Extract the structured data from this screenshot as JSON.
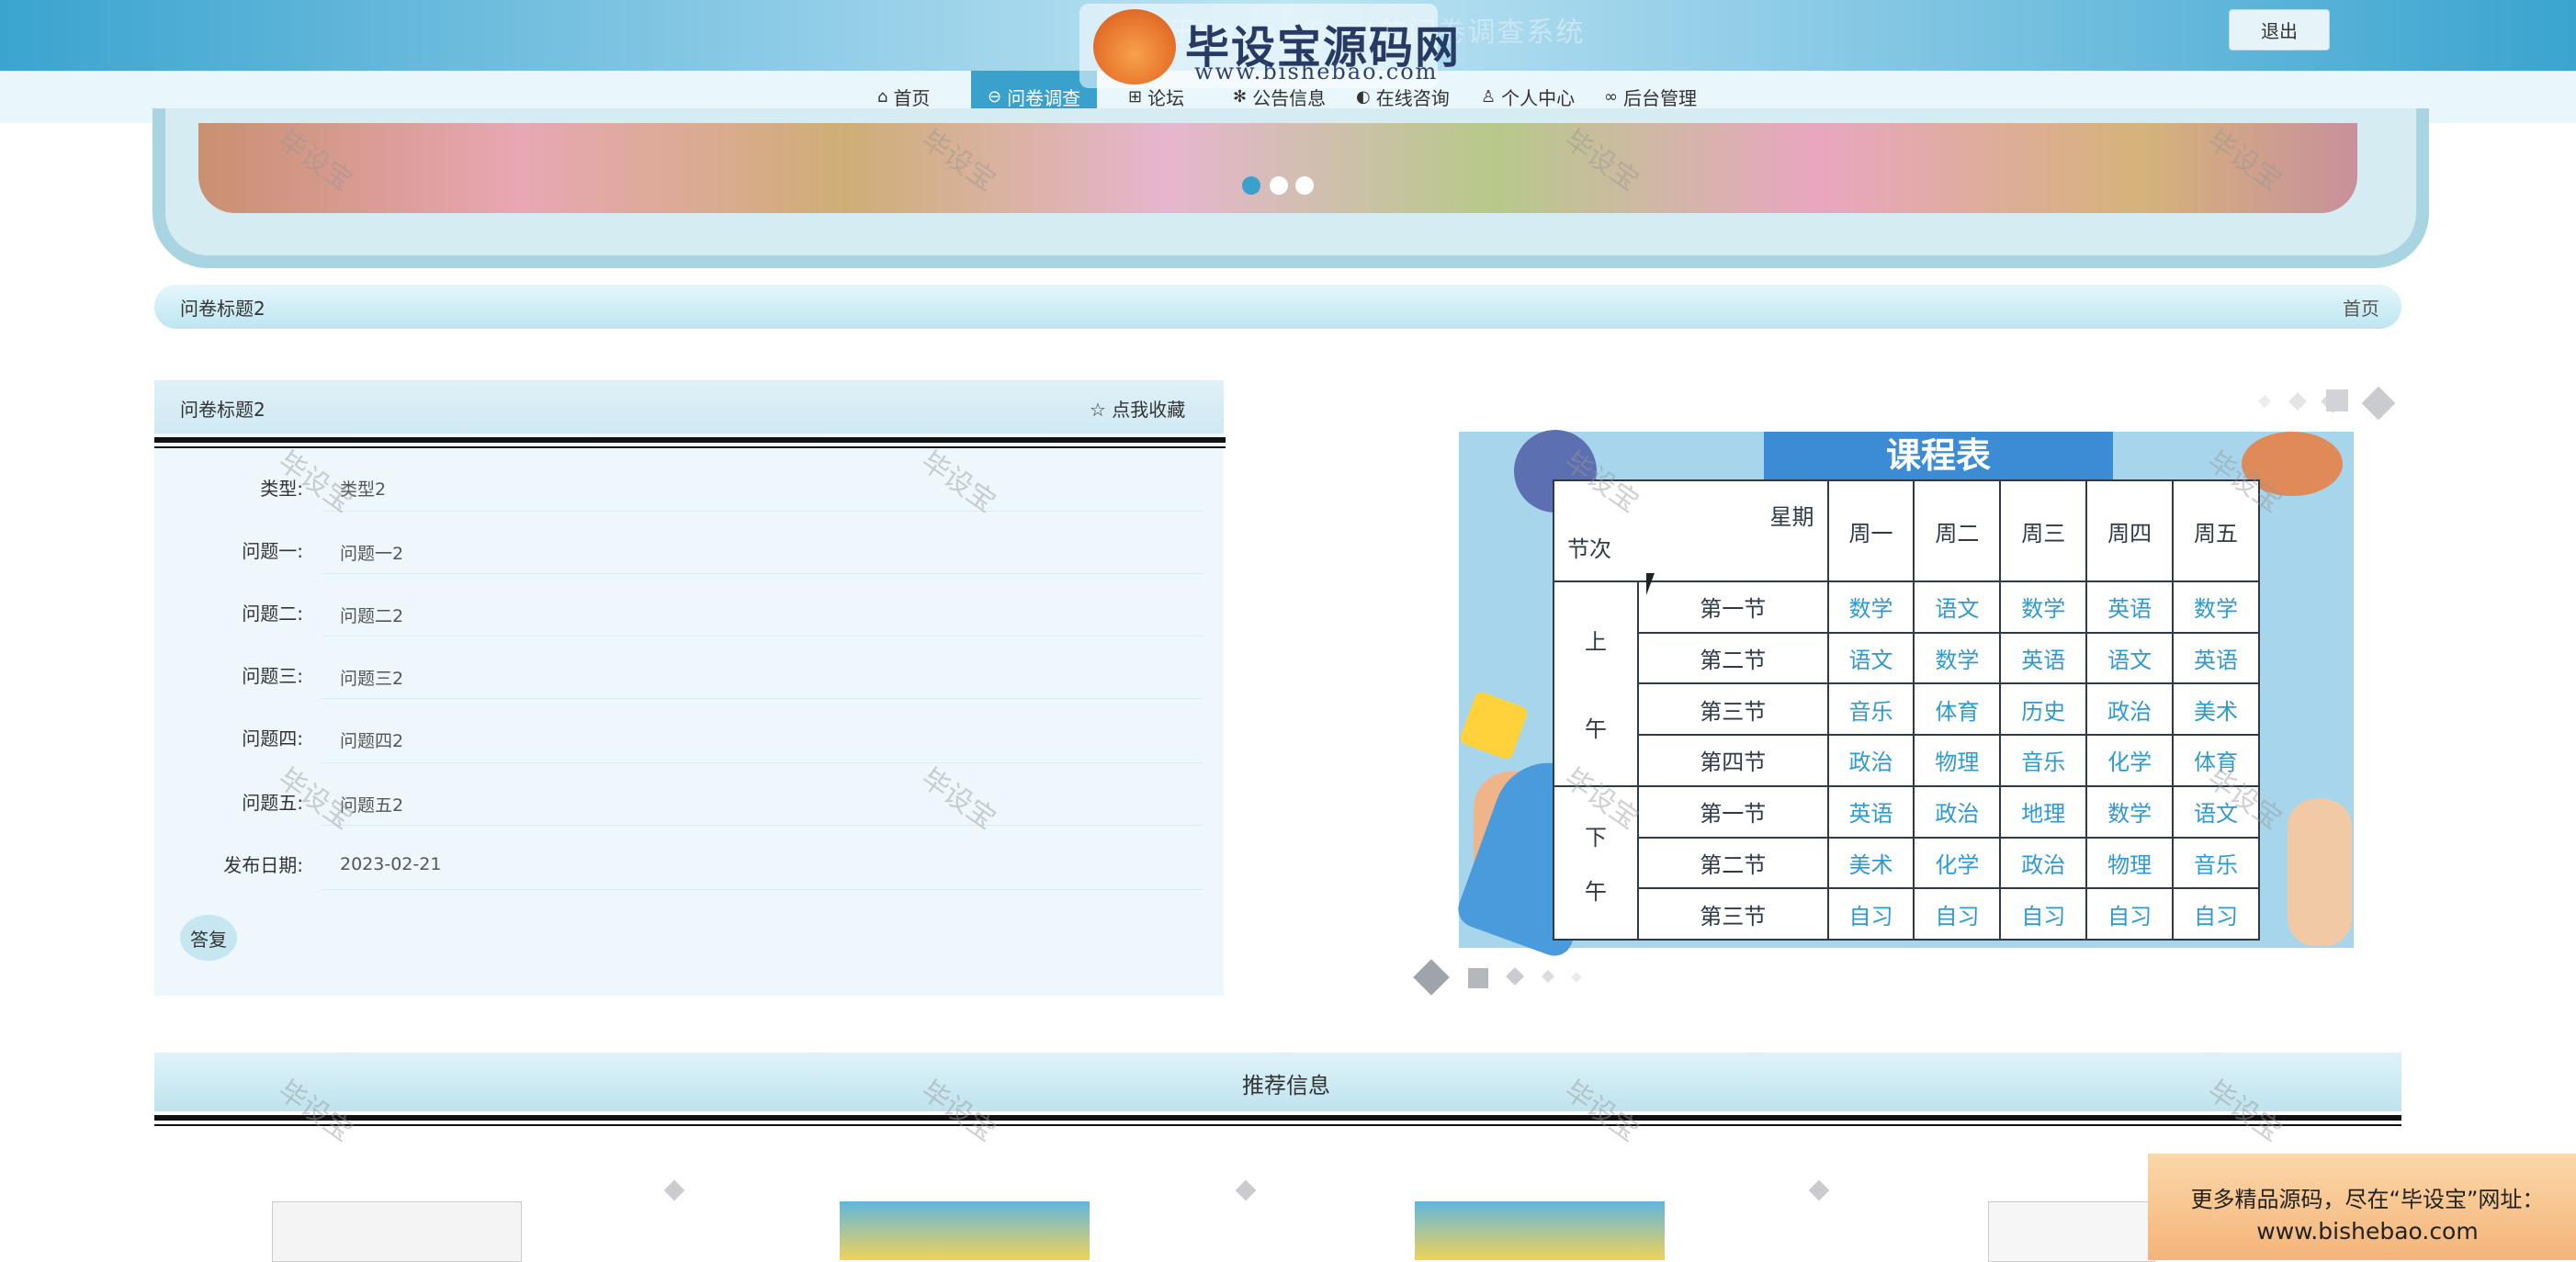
{
  "header": {
    "site_title": "基于Spring Boot的问卷调查系统",
    "logout_label": "退出",
    "logo_name": "毕设宝源码网",
    "logo_url": "www.bishebao.com"
  },
  "nav": {
    "items": [
      {
        "icon": "home-icon",
        "label": "首页"
      },
      {
        "icon": "survey-icon",
        "label": "问卷调查"
      },
      {
        "icon": "grid-icon",
        "label": "论坛"
      },
      {
        "icon": "snowflake-icon",
        "label": "公告信息"
      },
      {
        "icon": "chat-icon",
        "label": "在线咨询"
      },
      {
        "icon": "user-icon",
        "label": "个人中心"
      },
      {
        "icon": "link-icon",
        "label": "后台管理"
      }
    ],
    "active_index": 1
  },
  "breadcrumb": {
    "title": "问卷标题2",
    "home_label": "首页"
  },
  "detail": {
    "title": "问卷标题2",
    "collect_label": "☆ 点我收藏",
    "fields": [
      {
        "label": "类型:",
        "value": "类型2"
      },
      {
        "label": "问题一:",
        "value": "问题一2"
      },
      {
        "label": "问题二:",
        "value": "问题二2"
      },
      {
        "label": "问题三:",
        "value": "问题三2"
      },
      {
        "label": "问题四:",
        "value": "问题四2"
      },
      {
        "label": "问题五:",
        "value": "问题五2"
      },
      {
        "label": "发布日期:",
        "value": "2023-02-21"
      }
    ],
    "reply_label": "答复"
  },
  "schedule": {
    "title": "课程表",
    "header": [
      "星期",
      "周一",
      "周二",
      "周三",
      "周四",
      "周五"
    ],
    "corner_label": "节次",
    "period_am": [
      "上",
      "午"
    ],
    "period_pm": [
      "下",
      "午"
    ],
    "rows": [
      {
        "slot": "第一节",
        "cells": [
          "数学",
          "语文",
          "数学",
          "英语",
          "数学"
        ]
      },
      {
        "slot": "第二节",
        "cells": [
          "语文",
          "数学",
          "英语",
          "语文",
          "英语"
        ]
      },
      {
        "slot": "第三节",
        "cells": [
          "音乐",
          "体育",
          "历史",
          "政治",
          "美术"
        ]
      },
      {
        "slot": "第四节",
        "cells": [
          "政治",
          "物理",
          "音乐",
          "化学",
          "体育"
        ]
      },
      {
        "slot": "第一节",
        "cells": [
          "英语",
          "政治",
          "地理",
          "数学",
          "语文"
        ]
      },
      {
        "slot": "第二节",
        "cells": [
          "美术",
          "化学",
          "政治",
          "物理",
          "音乐"
        ]
      },
      {
        "slot": "第三节",
        "cells": [
          "自习",
          "自习",
          "自习",
          "自习",
          "自习"
        ]
      }
    ]
  },
  "recommend": {
    "title": "推荐信息"
  },
  "ad": {
    "line1": "更多精品源码，尽在“毕设宝”网址：",
    "line2": "www.bishebao.com"
  },
  "watermark": "毕设宝"
}
